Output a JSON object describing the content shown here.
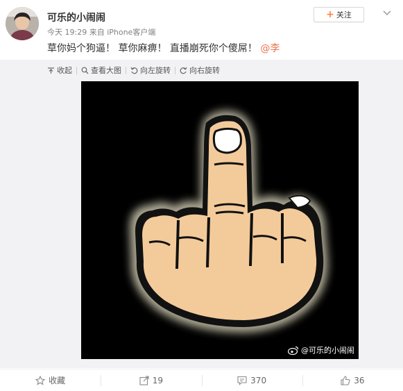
{
  "post": {
    "username": "可乐的小闹闹",
    "time": "今天 19:29",
    "source": "来自 iPhone客户端",
    "text": "草你妈个狗逼！ 草你麻痹！ 直播崩死你个傻屌！",
    "mention": "@李",
    "follow_label": "关注",
    "watermark": "@可乐的小闹闹"
  },
  "media_toolbar": {
    "collapse": "收起",
    "view_large": "查看大图",
    "rotate_left": "向左旋转",
    "rotate_right": "向右旋转"
  },
  "actions": {
    "favorite": "收藏",
    "repost": "19",
    "comment": "370",
    "like": "36"
  },
  "colors": {
    "accent_orange": "#ff8140",
    "mention": "#eb7350",
    "media_bg": "#f2f2f5"
  },
  "icons": [
    "avatar",
    "plus-icon",
    "chevron-down-icon",
    "collapse-icon",
    "search-icon",
    "rotate-left-icon",
    "rotate-right-icon",
    "weibo-logo-icon",
    "star-icon",
    "repost-icon",
    "comment-icon",
    "like-icon"
  ]
}
